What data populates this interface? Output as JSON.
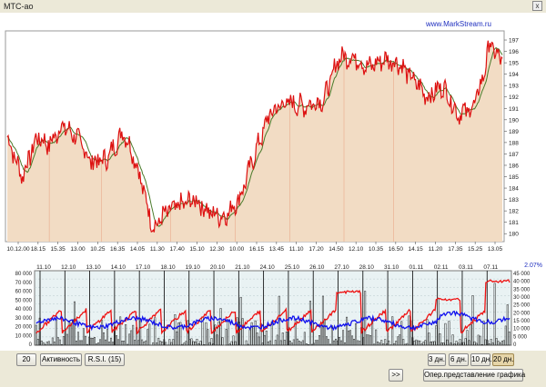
{
  "window": {
    "title": "МТС-ао",
    "close_label": "x"
  },
  "watermark": "www.MarkStream.ru",
  "price_chart": {
    "y_ticks": [
      "197",
      "196",
      "195",
      "194",
      "193",
      "192",
      "191",
      "190",
      "189",
      "188",
      "187",
      "186",
      "185",
      "184",
      "183",
      "182",
      "181",
      "180"
    ],
    "x_ticks": [
      "10.12.00",
      "18.15",
      "15.35",
      "13.00",
      "10.25",
      "16.35",
      "14.05",
      "11.30",
      "17.40",
      "15.10",
      "12.30",
      "10.00",
      "16.15",
      "13.45",
      "11.10",
      "17.20",
      "14.50",
      "12.10",
      "10.35",
      "16.50",
      "14.15",
      "11.20",
      "17.35",
      "15.25",
      "13.05"
    ],
    "colors": {
      "price": "#dd1111",
      "ma": "#4a7a2a",
      "area": "#f2dcc4"
    }
  },
  "volume_chart": {
    "pct_label": "2.07%",
    "date_ticks": [
      "11.10",
      "12.10",
      "13.10",
      "14.10",
      "17.10",
      "18.10",
      "19.10",
      "20.10",
      "21.10",
      "24.10",
      "25.10",
      "26.10",
      "27.10",
      "28.10",
      "31.10",
      "01.11",
      "02.11",
      "03.11",
      "07.11"
    ],
    "left_ticks": [
      "80 000",
      "70 000",
      "60 000",
      "50 000",
      "40 000",
      "30 000",
      "20 000",
      "10 000",
      "0"
    ],
    "right_ticks": [
      "45 000",
      "40 000",
      "35 000",
      "30 000",
      "25 000",
      "20 000",
      "15 000",
      "10 000",
      "5 000",
      "0"
    ]
  },
  "controls": {
    "period_value": "20",
    "activity_label": "Активность",
    "rsi_label": "R.S.I. (15)",
    "forward_label": ">>",
    "range_buttons": [
      "3 дн.",
      "6 дн.",
      "10 дн.",
      "20 дн."
    ],
    "selected_range": "20 дн.",
    "oper_label": "Опер.представление графика"
  }
}
